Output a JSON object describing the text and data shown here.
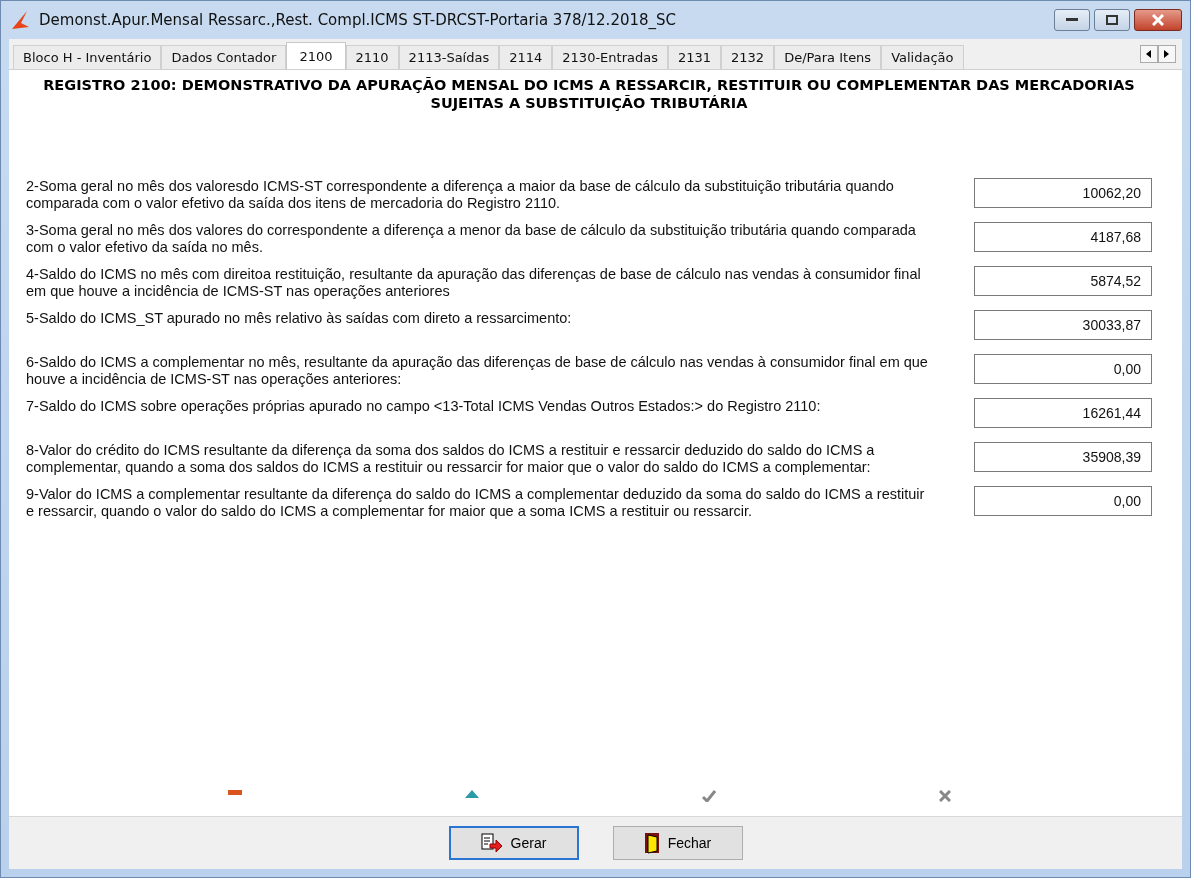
{
  "window": {
    "title": "Demonst.Apur.Mensal Ressarc.,Rest. Compl.ICMS ST-DRCST-Portaria 378/12.2018_SC"
  },
  "tabs": [
    {
      "label": "Bloco H - Inventário",
      "selected": false
    },
    {
      "label": "Dados Contador",
      "selected": false
    },
    {
      "label": "2100",
      "selected": true
    },
    {
      "label": "2110",
      "selected": false
    },
    {
      "label": "2113-Saídas",
      "selected": false
    },
    {
      "label": "2114",
      "selected": false
    },
    {
      "label": "2130-Entradas",
      "selected": false
    },
    {
      "label": "2131",
      "selected": false
    },
    {
      "label": "2132",
      "selected": false
    },
    {
      "label": "De/Para Itens",
      "selected": false
    },
    {
      "label": "Validação",
      "selected": false
    }
  ],
  "heading": "REGISTRO 2100: DEMONSTRATIVO DA APURAÇÃO MENSAL DO ICMS A RESSARCIR, RESTITUIR OU COMPLEMENTAR DAS MERCADORIAS SUJEITAS A SUBSTITUIÇÃO TRIBUTÁRIA",
  "fields": [
    {
      "label": "2-Soma geral no mês dos valoresdo ICMS-ST correspondente a diferença a maior da base de cálculo da substituição tributária quando comparada com o valor efetivo da saída dos itens de mercadoria do Registro 2110.",
      "value": "10062,20"
    },
    {
      "label": "3-Soma geral no mês dos valores do correspondente a diferença a menor da base de cálculo da substituição tributária quando comparada com o valor efetivo da saída no mês.",
      "value": "4187,68"
    },
    {
      "label": "4-Saldo do ICMS no mês com direitoa restituição, resultante da apuração das diferenças de base de cálculo nas vendas à consumidor final em que houve a incidência de ICMS-ST nas operações anteriores",
      "value": "5874,52"
    },
    {
      "label": "5-Saldo do ICMS_ST apurado no mês relativo às saídas com direto a ressarcimento:",
      "value": "30033,87"
    },
    {
      "label": "6-Saldo do ICMS a complementar no mês, resultante da apuração das diferenças de base de cálculo nas vendas à consumidor final em que houve a incidência de ICMS-ST nas operações anteriores:",
      "value": "0,00"
    },
    {
      "label": "7-Saldo do ICMS sobre operações próprias apurado no campo <13-Total ICMS Vendas Outros Estados:> do Registro 2110:",
      "value": "16261,44"
    },
    {
      "label": "8-Valor do crédito do ICMS resultante da diferença da soma dos saldos do ICMS a restituir e ressarcir deduzido do saldo do ICMS a complementar, quando a soma dos saldos do ICMS a restituir ou ressarcir for maior que o valor do saldo do ICMS a complementar:",
      "value": "35908,39"
    },
    {
      "label": "9-Valor do ICMS a complementar resultante da diferença do saldo do ICMS a complementar deduzido da soma do saldo do ICMS a restituir e ressarcir, quando o valor do saldo do ICMS a complementar for maior que a soma ICMS a restituir ou ressarcir.",
      "value": "0,00"
    }
  ],
  "buttons": [
    {
      "label": "Gerar",
      "kind": "generate",
      "selected": true
    },
    {
      "label": "Fechar",
      "kind": "close",
      "selected": false
    }
  ]
}
